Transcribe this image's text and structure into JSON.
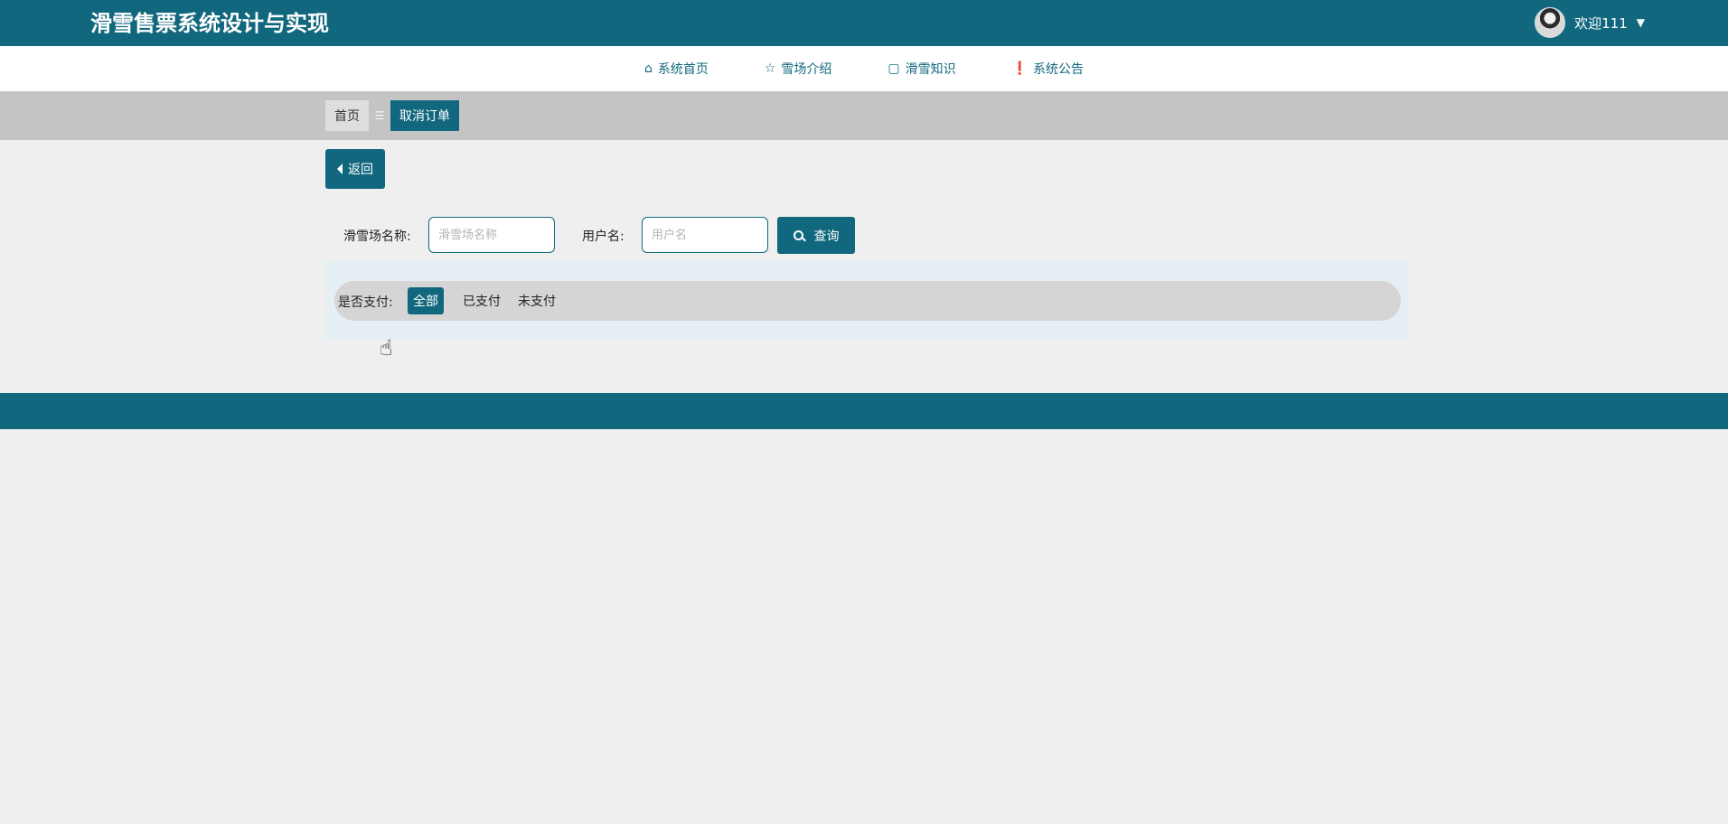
{
  "header": {
    "title": "滑雪售票系统设计与实现",
    "welcome": "欢迎111",
    "caret": "▼"
  },
  "nav": {
    "items": [
      {
        "icon": "⌂",
        "label": "系统首页"
      },
      {
        "icon": "☆",
        "label": "雪场介绍"
      },
      {
        "icon": "▢",
        "label": "滑雪知识"
      },
      {
        "icon": "❗",
        "label": "系统公告"
      }
    ]
  },
  "breadcrumb": {
    "home": "首页",
    "separator": "☰",
    "current": "取消订单"
  },
  "actions": {
    "back_label": "返回",
    "query_label": "查询"
  },
  "search": {
    "resort_label": "滑雪场名称:",
    "resort_placeholder": "滑雪场名称",
    "resort_value": "",
    "user_label": "用户名:",
    "user_placeholder": "用户名",
    "user_value": ""
  },
  "filter": {
    "label": "是否支付:",
    "options": [
      "全部",
      "已支付",
      "未支付"
    ],
    "selected": "全部"
  },
  "colors": {
    "primary": "#11687e",
    "page_bg": "#efefef",
    "breadcrumb_bg": "#c4c4c4",
    "filter_panel_bg": "#e6eff4",
    "filter_pill_bg": "#d5d5d5"
  }
}
